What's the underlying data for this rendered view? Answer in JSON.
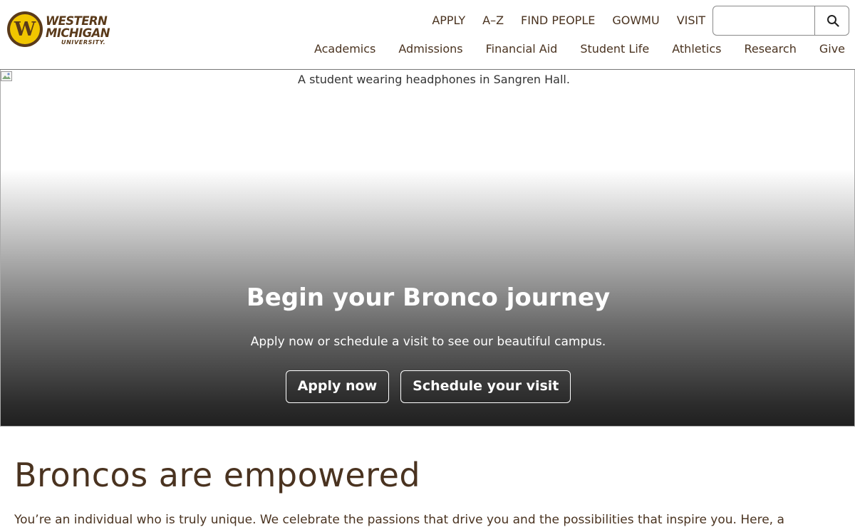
{
  "logo": {
    "seal_letter": "W",
    "line1": "WESTERN",
    "line2": "MICHIGAN",
    "line3": "UNIVERSITY."
  },
  "utility_nav": [
    {
      "label": "APPLY"
    },
    {
      "label": "A–Z"
    },
    {
      "label": "FIND PEOPLE"
    },
    {
      "label": "GOWMU"
    },
    {
      "label": "VISIT"
    }
  ],
  "search": {
    "value": "",
    "icon": "search-icon"
  },
  "main_nav": [
    {
      "label": "Academics"
    },
    {
      "label": "Admissions"
    },
    {
      "label": "Financial Aid"
    },
    {
      "label": "Student Life"
    },
    {
      "label": "Athletics"
    },
    {
      "label": "Research"
    },
    {
      "label": "Give"
    }
  ],
  "hero": {
    "image_alt": "A student wearing headphones in Sangren Hall.",
    "title": "Begin your Bronco journey",
    "subtitle": "Apply now or schedule a visit to see our beautiful campus.",
    "buttons": [
      {
        "label": "Apply now"
      },
      {
        "label": "Schedule your visit"
      }
    ]
  },
  "section": {
    "title": "Broncos are empowered",
    "text": "You’re an individual who is truly unique. We celebrate the passions that drive you and the possibilities that inspire you. Here, a"
  },
  "colors": {
    "brand_brown": "#5a3a1a",
    "brand_gold": "#f1c500",
    "text": "#4a3320"
  }
}
